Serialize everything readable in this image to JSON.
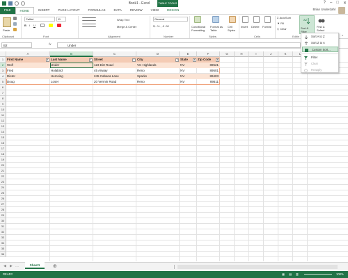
{
  "window": {
    "title": "Book1 - Excel",
    "context_tab": "TABLE TOOLS",
    "user": "Brian Underdahl"
  },
  "tabs": [
    "FILE",
    "HOME",
    "INSERT",
    "PAGE LAYOUT",
    "FORMULAS",
    "DATA",
    "REVIEW",
    "VIEW",
    "DESIGN"
  ],
  "ribbon": {
    "paste": "Paste",
    "clipboard": "Clipboard",
    "font_name": "Calibri",
    "font_size": "11",
    "font": "Font",
    "wrap_text": "Wrap Text",
    "merge_center": "Merge & Center",
    "alignment": "Alignment",
    "number_format": "General",
    "number": "Number",
    "conditional_formatting": "Conditional Formatting",
    "format_as_table": "Format as Table",
    "cell_styles": "Cell Styles",
    "styles": "Styles",
    "insert": "Insert",
    "delete": "Delete",
    "format": "Format",
    "cells": "Cells",
    "autosum": "AutoSum",
    "fill": "Fill",
    "clear": "Clear",
    "sort_filter": "Sort & Filter",
    "find_select": "Find & Select",
    "editing": "Editin"
  },
  "sort_menu": {
    "items": [
      "Sort A to Z",
      "Sort Z to A",
      "Custom Sort...",
      "Filter",
      "Clear",
      "Reapply"
    ]
  },
  "formula_bar": {
    "name_box": "B2",
    "fx": "fx",
    "value": "Under"
  },
  "columns": [
    "A",
    "B",
    "C",
    "D",
    "E",
    "F",
    "G",
    "H",
    "I",
    "J",
    "K",
    "L"
  ],
  "rows": [
    "1",
    "2",
    "3",
    "4",
    "5",
    "6",
    "7",
    "8",
    "9",
    "10",
    "11",
    "12",
    "13",
    "14",
    "15",
    "16",
    "17",
    "18",
    "19",
    "20",
    "21",
    "22",
    "23",
    "24",
    "25",
    "26",
    "27",
    "28",
    "29",
    "30",
    "31",
    "32",
    "33",
    "34",
    "35",
    "36"
  ],
  "table": {
    "headers": [
      "First Name",
      "Last Name",
      "Street",
      "City",
      "State",
      "Zip Code"
    ],
    "rows": [
      [
        "Wolf",
        "Under",
        "123 Dirt Road",
        "VC Highlands",
        "NV",
        "89521"
      ],
      [
        "Fred",
        "Holabird",
        "45 Airway",
        "Reno",
        "NV",
        "89501"
      ],
      [
        "Dieter",
        "Hemsing",
        "245 Cabana Lane",
        "Sparks",
        "NV",
        "89403"
      ],
      [
        "Doug",
        "Loser",
        "20 Vermin Road",
        "Reno",
        "NV",
        "89511"
      ]
    ]
  },
  "sheets": [
    "Sheet1"
  ],
  "add_sheet": "⊕",
  "status": {
    "ready": "READY",
    "zoom": "100%"
  },
  "colors": {
    "accent": "#217346",
    "header_fill": "#f4cbb4",
    "band_fill": "#fbe4d5"
  }
}
